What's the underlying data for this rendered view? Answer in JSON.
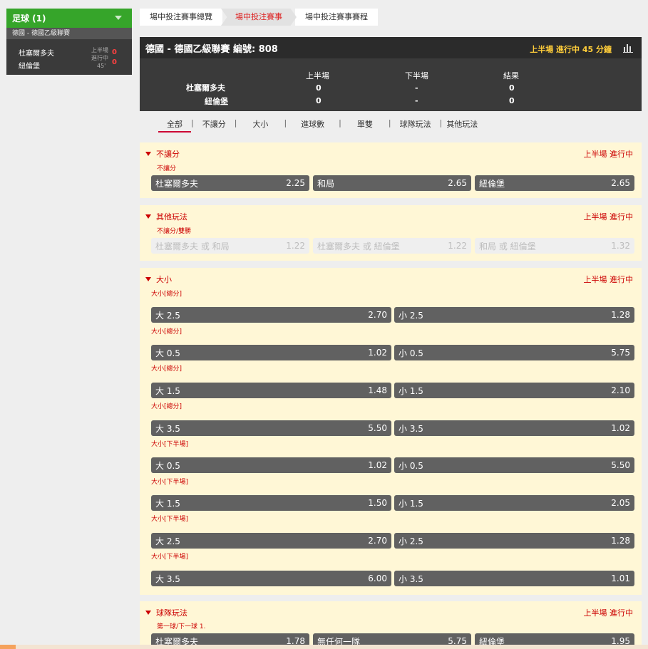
{
  "sidebar": {
    "sport": "足球 (1)",
    "league": "德國 - 德國乙級聯賽",
    "match": {
      "home": "杜塞爾多夫",
      "away": "紐倫堡",
      "status_line1": "上半場",
      "status_line2": "進行中",
      "minute": "45'",
      "home_score": "0",
      "away_score": "0"
    }
  },
  "tabs": [
    "場中投注賽事總覽",
    "場中投注賽事",
    "場中投注賽事賽程"
  ],
  "header": {
    "title": "德國 - 德國乙級聯賽 編號: 808",
    "status": "上半場 進行中 45 分鐘",
    "col_first_half": "上半場",
    "col_second_half": "下半場",
    "col_result": "結果",
    "home": "杜塞爾多夫",
    "away": "紐倫堡",
    "home_first": "0",
    "home_second": "-",
    "home_result": "0",
    "away_first": "0",
    "away_second": "-",
    "away_result": "0"
  },
  "filters": [
    "全部",
    "不讓分",
    "大小",
    "進球數",
    "單雙",
    "球隊玩法",
    "其他玩法"
  ],
  "filter_sep": "|",
  "markets": {
    "handicap": {
      "title": "不讓分",
      "status": "上半場 進行中",
      "sub": "不讓分",
      "odds": [
        {
          "label": "杜塞爾多夫",
          "value": "2.25"
        },
        {
          "label": "和局",
          "value": "2.65"
        },
        {
          "label": "紐倫堡",
          "value": "2.65"
        }
      ]
    },
    "other": {
      "title": "其他玩法",
      "status": "上半場 進行中",
      "sub": "不讓分/雙勝",
      "odds": [
        {
          "label": "杜塞爾多夫 或 和局",
          "value": "1.22"
        },
        {
          "label": "杜塞爾多夫 或 紐倫堡",
          "value": "1.22"
        },
        {
          "label": "和局 或 紐倫堡",
          "value": "1.32"
        }
      ]
    },
    "overunder": {
      "title": "大小",
      "status": "上半場 進行中",
      "rows": [
        {
          "sub": "大小[總分]",
          "over": "大 2.5",
          "over_v": "2.70",
          "under": "小 2.5",
          "under_v": "1.28"
        },
        {
          "sub": "大小[總分]",
          "over": "大 0.5",
          "over_v": "1.02",
          "under": "小 0.5",
          "under_v": "5.75"
        },
        {
          "sub": "大小[總分]",
          "over": "大 1.5",
          "over_v": "1.48",
          "under": "小 1.5",
          "under_v": "2.10"
        },
        {
          "sub": "大小[總分]",
          "over": "大 3.5",
          "over_v": "5.50",
          "under": "小 3.5",
          "under_v": "1.02"
        },
        {
          "sub": "大小[下半場]",
          "over": "大 0.5",
          "over_v": "1.02",
          "under": "小 0.5",
          "under_v": "5.50"
        },
        {
          "sub": "大小[下半場]",
          "over": "大 1.5",
          "over_v": "1.50",
          "under": "小 1.5",
          "under_v": "2.05"
        },
        {
          "sub": "大小[下半場]",
          "over": "大 2.5",
          "over_v": "2.70",
          "under": "小 2.5",
          "under_v": "1.28"
        },
        {
          "sub": "大小[下半場]",
          "over": "大 3.5",
          "over_v": "6.00",
          "under": "小 3.5",
          "under_v": "1.01"
        }
      ]
    },
    "team": {
      "title": "球隊玩法",
      "status": "上半場 進行中",
      "sub": "第一球/下一球 1.",
      "odds": [
        {
          "label": "杜塞爾多夫",
          "value": "1.78"
        },
        {
          "label": "無任何一隊",
          "value": "5.75"
        },
        {
          "label": "紐倫堡",
          "value": "1.95"
        }
      ]
    }
  }
}
